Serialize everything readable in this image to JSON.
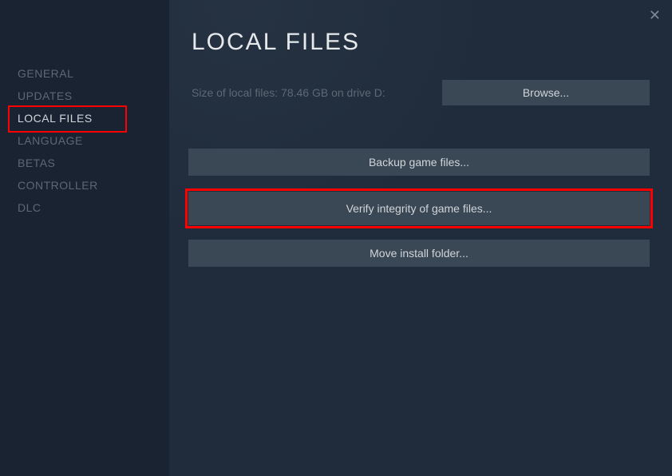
{
  "sidebar": {
    "items": [
      {
        "label": "General"
      },
      {
        "label": "Updates"
      },
      {
        "label": "Local Files"
      },
      {
        "label": "Language"
      },
      {
        "label": "Betas"
      },
      {
        "label": "Controller"
      },
      {
        "label": "DLC"
      }
    ]
  },
  "main": {
    "title": "Local Files",
    "info_text": "Size of local files: 78.46 GB on drive D:",
    "browse_label": "Browse...",
    "buttons": {
      "backup": "Backup game files...",
      "verify": "Verify integrity of game files...",
      "move": "Move install folder..."
    }
  },
  "close_label": "✕"
}
